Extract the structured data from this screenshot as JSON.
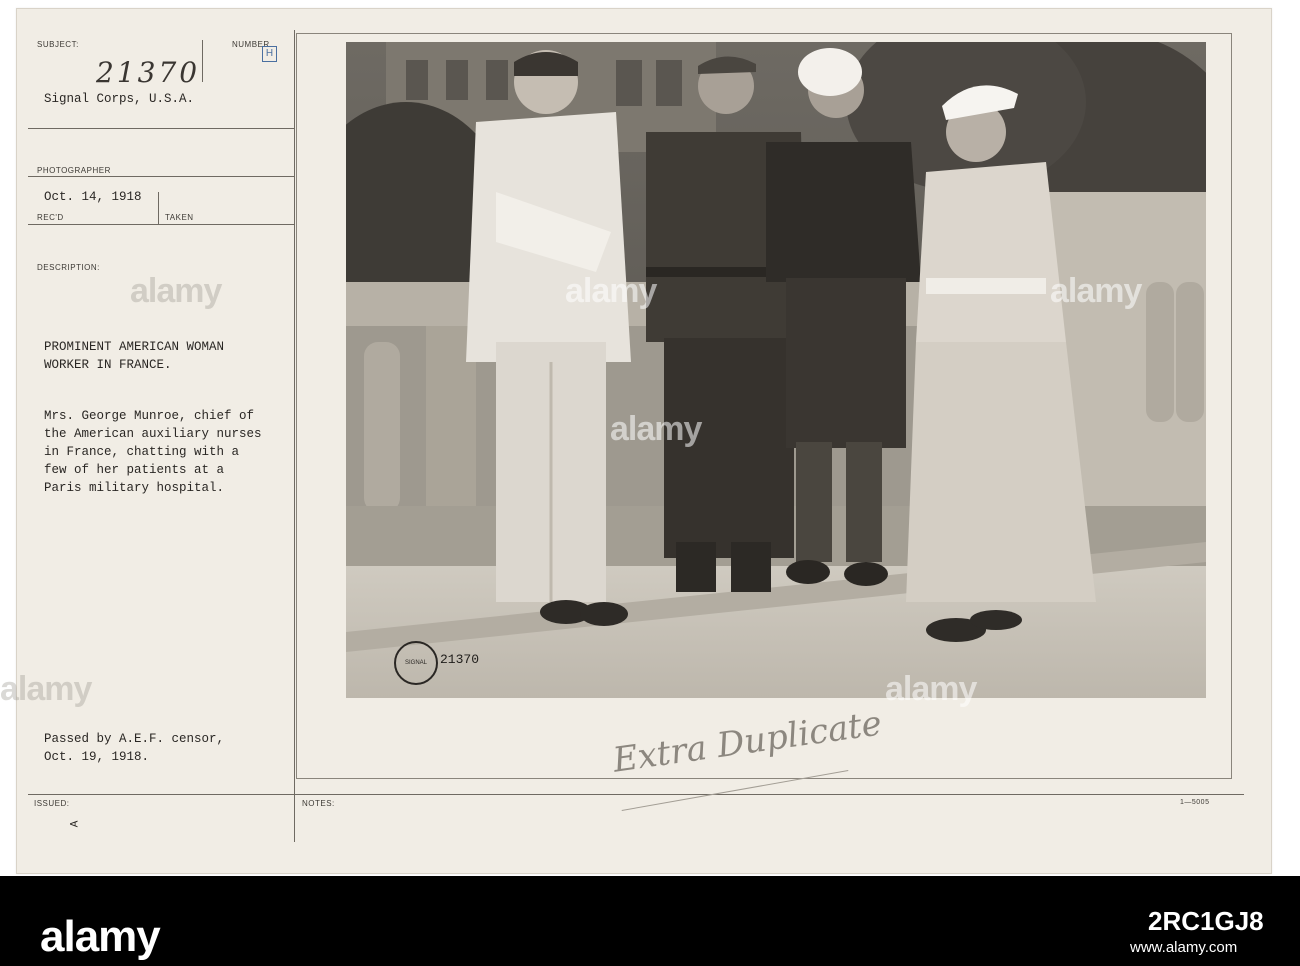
{
  "card": {
    "labels": {
      "subject": "SUBJECT:",
      "number": "NUMBER",
      "photographer": "PHOTOGRAPHER",
      "recd": "REC'D",
      "taken": "TAKEN",
      "description": "DESCRIPTION:",
      "issued": "ISSUED:",
      "notes": "NOTES:"
    },
    "handwritten_number": "21370",
    "number_stamp": "H",
    "unit": "Signal Corps, U.S.A.",
    "date": "Oct. 14, 1918",
    "headline": [
      "PROMINENT AMERICAN WOMAN",
      "WORKER IN FRANCE."
    ],
    "description_lines": [
      "Mrs. George Munroe, chief of",
      "the American auxiliary nurses",
      "in France, chatting with a",
      "few of her patients at a",
      "Paris military hospital."
    ],
    "censor_lines": [
      "Passed by A.E.F. censor,",
      "Oct. 19, 1918."
    ],
    "issued_mark": "A",
    "form_code": "1—5005",
    "photo_number": "21370",
    "photo_seal": "SIGNAL CORPS U.S.A.",
    "annotation": "Extra Duplicate"
  },
  "watermark": {
    "text": "alamy"
  },
  "footer": {
    "logo": "alamy",
    "image_id": "2RC1GJ8",
    "url": "www.alamy.com"
  }
}
